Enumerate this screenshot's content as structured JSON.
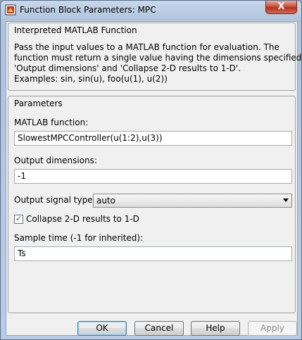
{
  "window": {
    "title": "Function Block Parameters: MPC",
    "close_label": "X"
  },
  "description": {
    "group_title": "Interpreted MATLAB Function",
    "lines": [
      "Pass the input values to a MATLAB function for evaluation.  The",
      "function must return a single value having the dimensions specified by",
      "'Output dimensions' and 'Collapse 2-D results to 1-D'.",
      "Examples: sin, sin(u), foo(u(1), u(2))"
    ]
  },
  "parameters": {
    "group_title": "Parameters",
    "matlab_function_label": "MATLAB function:",
    "matlab_function_value": "SlowestMPCController(u(1:2),u(3))",
    "output_dimensions_label": "Output dimensions:",
    "output_dimensions_value": "-1",
    "output_signal_type_label": "Output signal type:",
    "output_signal_type_value": "auto",
    "collapse_label": "Collapse 2-D results to 1-D",
    "collapse_checked": true,
    "collapse_mark": "✓",
    "sample_time_label": "Sample time (-1 for inherited):",
    "sample_time_value": "Ts"
  },
  "buttons": {
    "ok": "OK",
    "cancel": "Cancel",
    "help": "Help",
    "apply": "Apply"
  },
  "icons": {
    "app": "simulink-block-icon",
    "close": "close-icon",
    "dropdown": "chevron-down-icon"
  }
}
